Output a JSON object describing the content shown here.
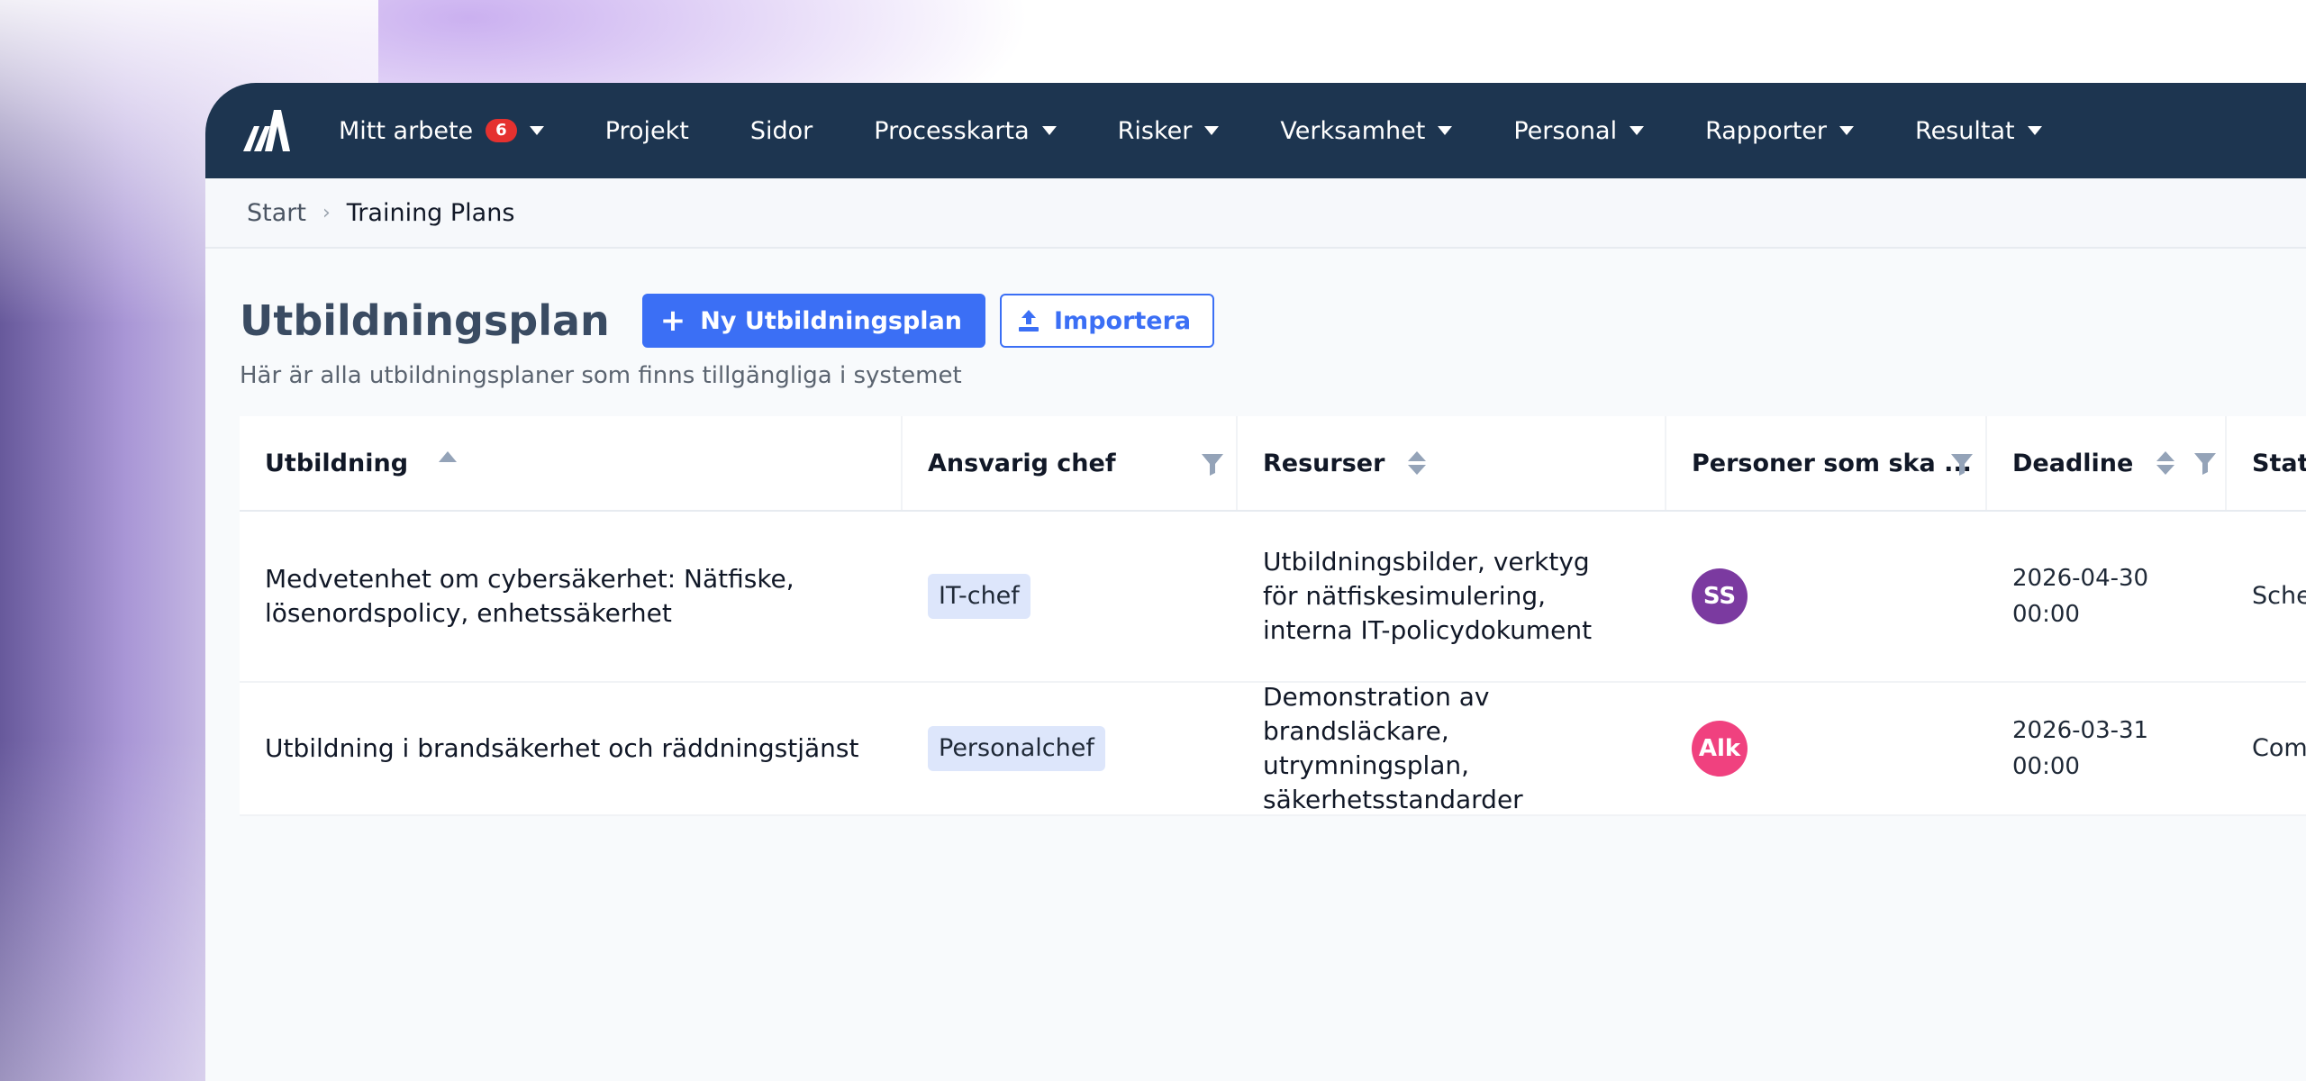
{
  "colors": {
    "nav_bg": "#1d3550",
    "primary": "#3b6ff5",
    "badge": "#e5312f",
    "tag_bg": "#dde6fb"
  },
  "nav": {
    "logo_icon": "logo-icon",
    "items": [
      {
        "label": "Mitt arbete",
        "badge": "6",
        "dropdown": true
      },
      {
        "label": "Projekt",
        "dropdown": false
      },
      {
        "label": "Sidor",
        "dropdown": false
      },
      {
        "label": "Processkarta",
        "dropdown": true
      },
      {
        "label": "Risker",
        "dropdown": true
      },
      {
        "label": "Verksamhet",
        "dropdown": true
      },
      {
        "label": "Personal",
        "dropdown": true
      },
      {
        "label": "Rapporter",
        "dropdown": true
      },
      {
        "label": "Resultat",
        "dropdown": true
      }
    ]
  },
  "breadcrumb": {
    "start": "Start",
    "current": "Training Plans"
  },
  "page": {
    "title": "Utbildningsplan",
    "new_button": "Ny Utbildningsplan",
    "import_button": "Importera",
    "subtitle": "Här är alla utbildningsplaner som finns tillgängliga i systemet"
  },
  "table": {
    "columns": [
      "Utbildning",
      "Ansvarig chef",
      "Resurser",
      "Personer som ska ...",
      "Deadline",
      "Stat"
    ],
    "rows": [
      {
        "utbildning": "Medvetenhet om cybersäkerhet: Nätfiske, lösenordspolicy, enhetssäkerhet",
        "chef": "IT-chef",
        "resurser": "Utbildningsbilder, verktyg för nätfiskesimulering, interna IT-policydokument",
        "avatar_initials": "SS",
        "avatar_color": "#7b3aa0",
        "deadline_date": "2026-04-30",
        "deadline_time": "00:00",
        "status": "Sche"
      },
      {
        "utbildning": "Utbildning i brandsäkerhet och räddningstjänst",
        "chef": "Personalchef",
        "resurser": "Demonstration av brandsläckare, utrymningsplan, säkerhetsstandarder",
        "avatar_initials": "Alk",
        "avatar_color": "#f0417f",
        "deadline_date": "2026-03-31",
        "deadline_time": "00:00",
        "status": "Com"
      }
    ]
  }
}
